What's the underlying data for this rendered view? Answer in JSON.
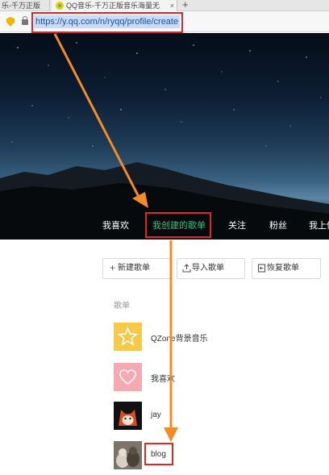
{
  "browser": {
    "tabs": [
      {
        "label": "乐-千万正版"
      },
      {
        "label": "QQ音乐-千万正版音乐海量无"
      }
    ],
    "new_tab_label": "+",
    "close_label": "×",
    "url": "https://y.qq.com/n/ryqq/profile/create"
  },
  "hero": {
    "nav": [
      {
        "label": "我喜欢"
      },
      {
        "label": "我创建的歌单"
      },
      {
        "label": "关注"
      },
      {
        "label": "粉丝"
      },
      {
        "label": "我上传"
      }
    ]
  },
  "actions": {
    "new_playlist": "新建歌单",
    "import_playlist": "导入歌单",
    "restore_playlist": "恢复歌单"
  },
  "section_label": "歌单",
  "playlists": [
    {
      "name": "QZone背景音乐"
    },
    {
      "name": "我喜欢"
    },
    {
      "name": "jay"
    },
    {
      "name": "blog"
    }
  ],
  "colors": {
    "accent_green": "#31c27c",
    "highlight_red": "#e02727",
    "arrow_orange": "#f28c28"
  }
}
